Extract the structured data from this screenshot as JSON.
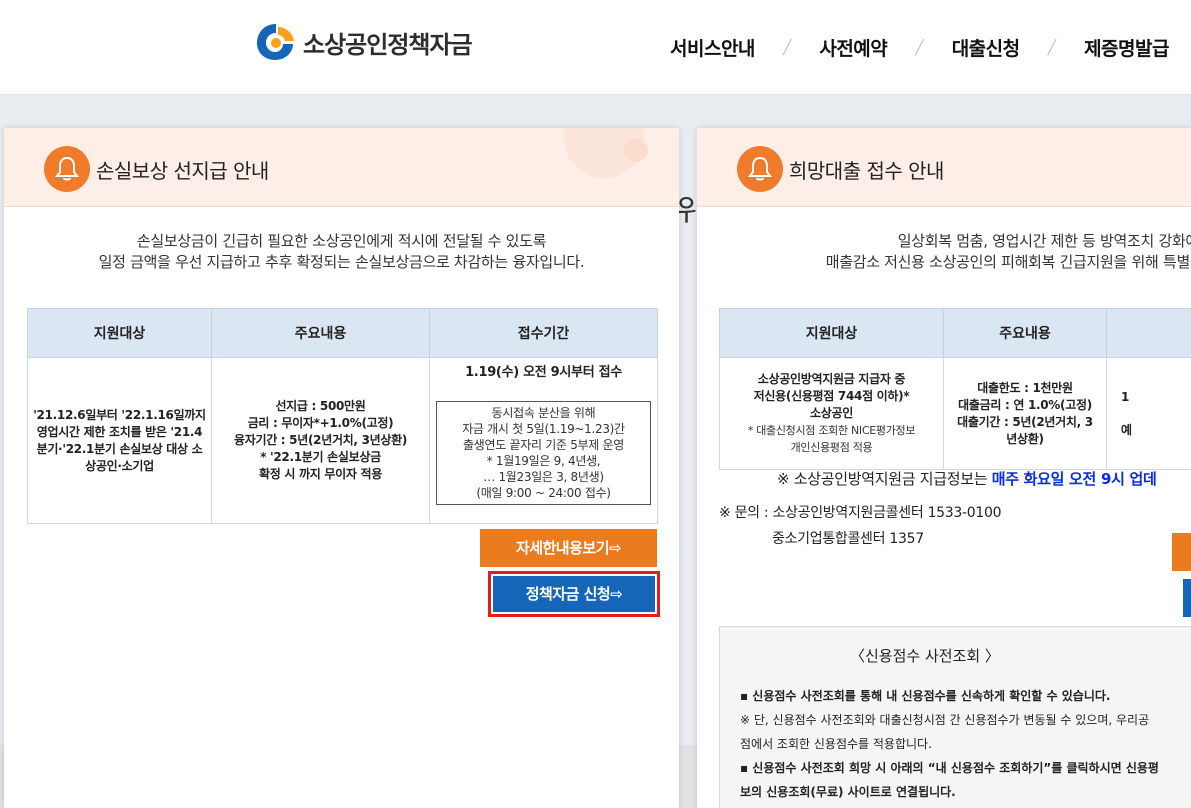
{
  "header": {
    "logo_text": "소상공인정책자금",
    "nav": [
      "서비스안내",
      "사전예약",
      "대출신청",
      "제증명발급"
    ]
  },
  "background_text": "위",
  "left_panel": {
    "title": "손실보상 선지급 안내",
    "intro": [
      "손실보상금이 긴급히 필요한 소상공인에게 적시에 전달될 수 있도록",
      "일정 금액을 우선 지급하고 추후 확정되는 손실보상금으로 차감하는 융자입니다."
    ],
    "table": {
      "headers": [
        "지원대상",
        "주요내용",
        "접수기간"
      ],
      "target": "'21.12.6일부터 '22.1.16일까지 영업시간 제한 조치를 받은 '21.4분기·'22.1분기 손실보상 대상 소상공인·소기업",
      "content": [
        "선지급 : 500만원",
        "금리 : 무이자*+1.0%(고정)",
        "융자기간 : 5년(2년거치, 3년상환)",
        "* '22.1분기 손실보상금",
        "확정 시 까지 무이자 적용"
      ],
      "period_top": "1.19(수) 오전 9시부터 접수",
      "period_box": [
        "동시접속 분산을 위해",
        "자금 개시 첫 5일(1.19~1.23)간",
        "출생연도 끝자리 기준 5부제 운영",
        "* 1월19일은 9, 4년생,",
        "… 1월23일은 3, 8년생)",
        "(매일 9:00 ~ 24:00 접수)"
      ]
    },
    "detail_button": "자세한내용보기⇨",
    "apply_button": "정책자금 신청⇨"
  },
  "right_panel": {
    "title": "희망대출 접수 안내",
    "intro": [
      "일상회복 멈춤, 영업시간 제한 등 방역조치 강화에 따",
      "매출감소 저신용 소상공인의 피해회복 긴급지원을 위해 특별융자"
    ],
    "table": {
      "headers": [
        "지원대상",
        "주요내용",
        ""
      ],
      "target": [
        "소상공인방역지원금 지급자 중",
        "저신용(신용평점 744점 이하)*",
        "소상공인"
      ],
      "target_note": [
        "* 대출신청시점 조회한 NICE평가정보",
        "개인신용평점 적용"
      ],
      "content": [
        "대출한도 : 1천만원",
        "대출금리 : 연 1.0%(고정)",
        "대출기간 : 5년(2년거치, 3",
        "년상환)"
      ],
      "partial": [
        "1",
        "예"
      ]
    },
    "notice_prefix": "※ 소상공인방역지원금 지급정보는 ",
    "notice_highlight": "매주 화요일 오전 9시 업데",
    "contact_line1": "※ 문의 : 소상공인방역지원금콜센터 1533-0100",
    "contact_line2": "중소기업통합콜센터 1357",
    "credit": {
      "title": "〈신용점수 사전조회 〉",
      "lines": [
        "▪ 신용점수 사전조회를 통해 내 신용점수를 신속하게 확인할 수 있습니다.",
        "※ 단, 신용점수 사전조회와 대출신청시점 간 신용점수가 변동될 수 있으며, 우리공",
        "점에서 조회한 신용점수를 적용합니다.",
        "▪ 신용점수 사전조회 희망 시 아래의 “내 신용점수 조회하기”를 클릭하시면 신용평",
        "보의 신용조회(무료) 사이트로 연결됩니다."
      ]
    }
  },
  "colors": {
    "accent_orange": "#ea7b1f",
    "primary_blue": "#1565b8",
    "highlight_blue": "#0a2be0",
    "outline_red": "#e01f1f"
  }
}
